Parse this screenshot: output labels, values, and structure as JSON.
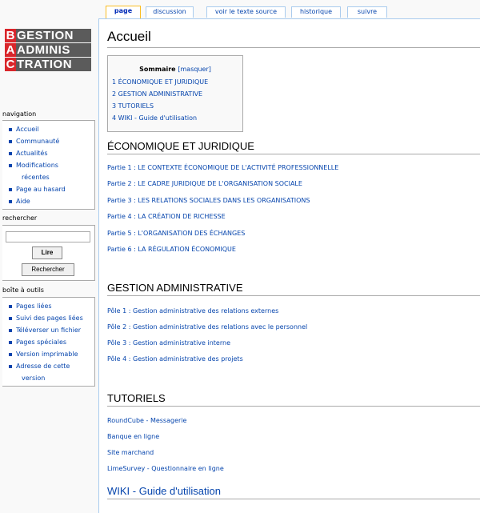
{
  "tabs": [
    {
      "label": "page"
    },
    {
      "label": "discussion"
    },
    {
      "label": "voir le texte source"
    },
    {
      "label": "historique"
    },
    {
      "label": "suivre"
    }
  ],
  "logo": {
    "rows": [
      {
        "letter": "B",
        "text": "GESTION"
      },
      {
        "letter": "A",
        "text": "ADMINIS"
      },
      {
        "letter": "C",
        "text": "TRATION"
      }
    ]
  },
  "sidebar": {
    "navigation": {
      "title": "navigation",
      "items": [
        "Accueil",
        "Communauté",
        "Actualités",
        "Modifications",
        "récentes",
        "Page au hasard",
        "Aide"
      ]
    },
    "search": {
      "title": "rechercher",
      "input_value": "",
      "go_label": "Lire",
      "search_label": "Rechercher"
    },
    "toolbox": {
      "title": "boîte à outils",
      "items": [
        "Pages liées",
        "Suivi des pages liées",
        "Téléverser un fichier",
        "Pages spéciales",
        "Version imprimable",
        "Adresse de cette",
        "version"
      ]
    }
  },
  "main": {
    "title": "Accueil",
    "toc": {
      "title": "Sommaire",
      "toggle": "[masquer]",
      "items": [
        "1 ÉCONOMIQUE ET JURIDIQUE",
        "2 GESTION ADMINISTRATIVE",
        "3 TUTORIELS",
        "4 WIKI - Guide d'utilisation"
      ]
    },
    "sections": [
      {
        "heading": "ÉCONOMIQUE ET JURIDIQUE",
        "links": [
          "Partie 1 : LE CONTEXTE ÉCONOMIQUE DE L'ACTIVITÉ PROFESSIONNELLE",
          "Partie 2 : LE CADRE JURIDIQUE DE L'ORGANISATION SOCIALE",
          "Partie 3 : LES RELATIONS SOCIALES DANS LES ORGANISATIONS",
          "Partie 4 : LA CRÉATION DE RICHESSE",
          "Partie 5 : L'ORGANISATION DES ÉCHANGES",
          "Partie 6 : LA RÉGULATION ÉCONOMIQUE"
        ]
      },
      {
        "heading": "GESTION ADMINISTRATIVE",
        "links": [
          "Pôle 1 : Gestion administrative des relations externes",
          "Pôle 2 : Gestion administrative des relations avec le personnel",
          "Pôle 3 : Gestion administrative interne",
          "Pôle 4 : Gestion administrative des projets"
        ]
      },
      {
        "heading": "TUTORIELS",
        "links": [
          "RoundCube - Messagerie",
          "Banque en ligne",
          "Site marchand",
          "LimeSurvey - Questionnaire en ligne"
        ]
      },
      {
        "heading": "WIKI - Guide d'utilisation",
        "links": []
      }
    ]
  }
}
